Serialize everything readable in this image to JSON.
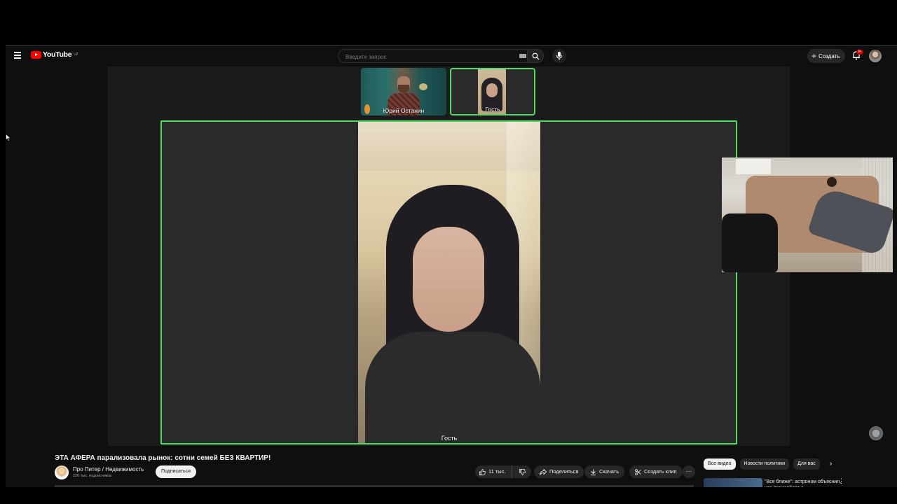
{
  "header": {
    "logo_text": "YouTube",
    "logo_sup": "UZ",
    "search_placeholder": "Введите запрос",
    "create_label": "Создать",
    "notifications_badge": "9+"
  },
  "call": {
    "thumbnails": [
      {
        "label": "Юрий Останин"
      },
      {
        "label": "Гость"
      }
    ],
    "main_label": "Гость"
  },
  "video": {
    "title": "ЭТА АФЕРА парализовала рынок: сотни семей БЕЗ КВАРТИР!",
    "channel_name": "Про Питер / Недвижимость",
    "subscribers": "226 тыс. подписчиков",
    "subscribe_label": "Подписаться",
    "likes": "11 тыс.",
    "share_label": "Поделиться",
    "download_label": "Скачать",
    "clip_label": "Создать клип",
    "more_label": "···"
  },
  "sidebar": {
    "chips": [
      "Все видео",
      "Новости политики",
      "Для вас"
    ],
    "recommendation_title": "\"Все ближе\": астроном объяснил, что произойдет с"
  },
  "colors": {
    "active_speaker_border": "#4ddc62",
    "brand_red": "#ff0000",
    "background": "#0f0f0f"
  }
}
